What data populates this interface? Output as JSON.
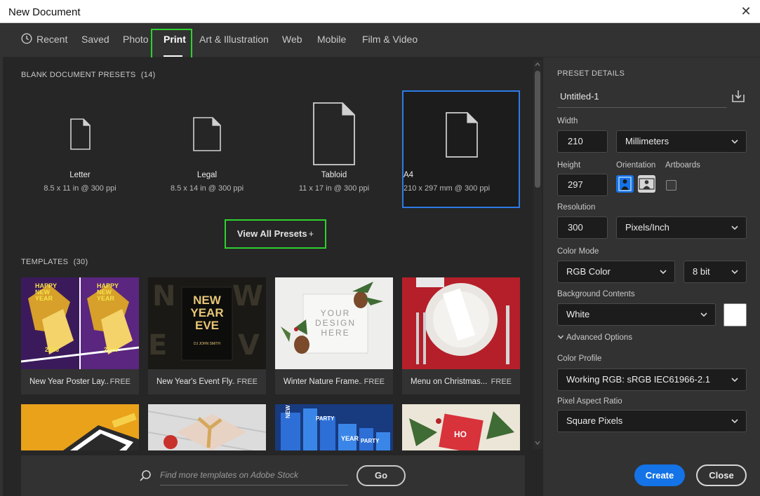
{
  "window": {
    "title": "New Document"
  },
  "tabs": [
    {
      "label": "Recent"
    },
    {
      "label": "Saved"
    },
    {
      "label": "Photo"
    },
    {
      "label": "Print"
    },
    {
      "label": "Art & Illustration"
    },
    {
      "label": "Web"
    },
    {
      "label": "Mobile"
    },
    {
      "label": "Film & Video"
    }
  ],
  "active_tab": "Print",
  "presets_section": {
    "title": "BLANK DOCUMENT PRESETS",
    "count": "(14)"
  },
  "presets": [
    {
      "name": "Letter",
      "desc": "8.5 x 11 in @ 300 ppi"
    },
    {
      "name": "Legal",
      "desc": "8.5 x 14 in @ 300 ppi"
    },
    {
      "name": "Tabloid",
      "desc": "11 x 17 in @ 300 ppi"
    },
    {
      "name": "A4",
      "desc": "210 x 297 mm @ 300 ppi"
    }
  ],
  "view_all_label": "View All Presets",
  "view_all_plus": "+",
  "templates_section": {
    "title": "TEMPLATES",
    "count": "(30)"
  },
  "templates": [
    {
      "caption": "New Year Poster Lay...",
      "badge": "FREE"
    },
    {
      "caption": "New Year's Event Fly...",
      "badge": "FREE"
    },
    {
      "caption": "Winter Nature Frame...",
      "badge": "FREE"
    },
    {
      "caption": "Menu on Christmas...",
      "badge": "FREE"
    }
  ],
  "thumb_text": {
    "poster_happy": "HAPPY",
    "poster_new": "NEW",
    "poster_year": "YEAR",
    "poster_year_num": "2026",
    "poster_club": "CLUB",
    "eve_line1": "NEW",
    "eve_line2": "YEAR",
    "eve_line3": "EVE",
    "eve_sub": "DJ JOHN SMITH",
    "frame_line1": "YOUR",
    "frame_line2": "DESIGN",
    "frame_line3": "HERE",
    "party_a": "NEW YEAR",
    "party_b": "PARTY",
    "party_c": "YEAR",
    "party_d": "PARTY",
    "card_ho": "HO"
  },
  "search": {
    "placeholder": "Find more templates on Adobe Stock",
    "go_label": "Go"
  },
  "details": {
    "heading": "PRESET DETAILS",
    "name": "Untitled-1",
    "width_label": "Width",
    "width_value": "210",
    "width_unit": "Millimeters",
    "height_label": "Height",
    "height_value": "297",
    "orientation_label": "Orientation",
    "artboards_label": "Artboards",
    "resolution_label": "Resolution",
    "resolution_value": "300",
    "resolution_unit": "Pixels/Inch",
    "color_mode_label": "Color Mode",
    "color_mode": "RGB Color",
    "bit_depth": "8 bit",
    "bg_label": "Background Contents",
    "bg_value": "White",
    "bg_color": "#ffffff",
    "advanced_label": "Advanced Options",
    "profile_label": "Color Profile",
    "profile_value": "Working RGB: sRGB IEC61966-2.1",
    "par_label": "Pixel Aspect Ratio",
    "par_value": "Square Pixels"
  },
  "buttons": {
    "create": "Create",
    "close": "Close"
  },
  "icons": {
    "window_close": "close-icon",
    "recent": "clock-icon",
    "document": "document-icon",
    "search": "search-icon",
    "save_preset": "save-preset-icon",
    "portrait": "portrait-orientation-icon",
    "landscape": "landscape-orientation-icon",
    "chevron": "chevron-down-icon"
  },
  "colors": {
    "accent": "#1473e6",
    "selection": "#2d7be6",
    "highlight": "#2fd12f"
  }
}
